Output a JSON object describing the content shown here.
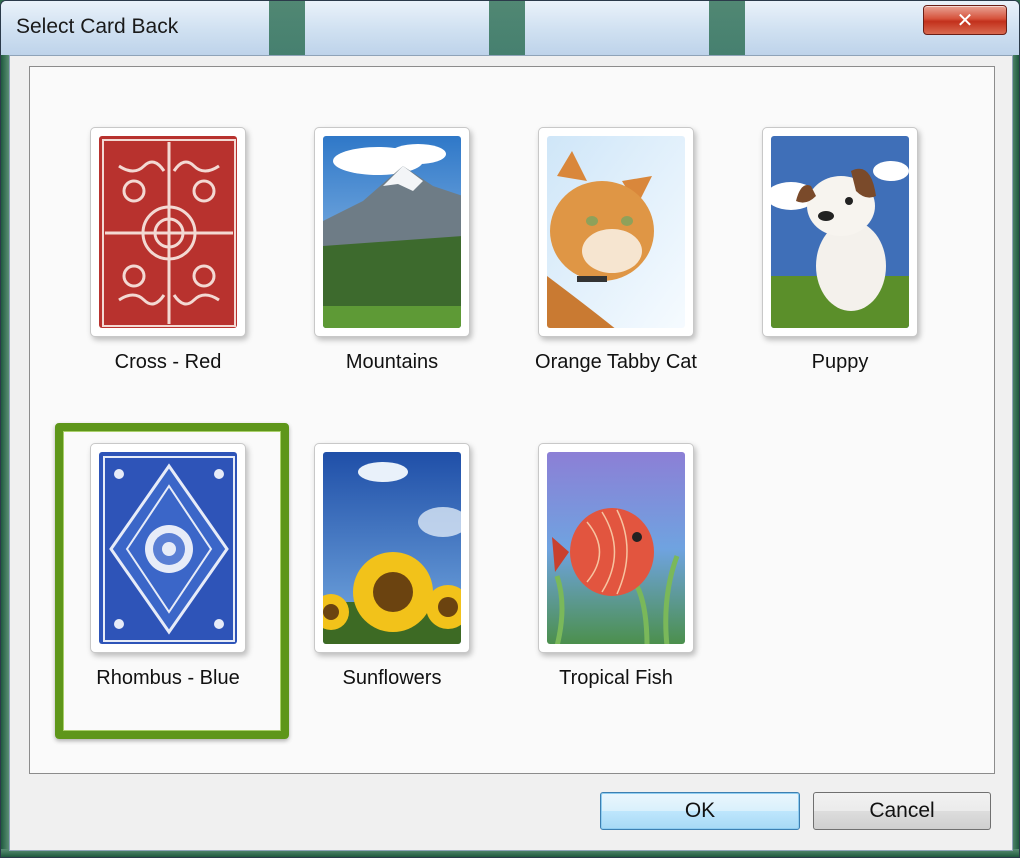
{
  "window": {
    "title": "Select Card Back",
    "close_label": "✕"
  },
  "cards": [
    {
      "label": "Cross - Red",
      "selected": false
    },
    {
      "label": "Mountains",
      "selected": false
    },
    {
      "label": "Orange Tabby Cat",
      "selected": false
    },
    {
      "label": "Puppy",
      "selected": false
    },
    {
      "label": "Rhombus - Blue",
      "selected": true
    },
    {
      "label": "Sunflowers",
      "selected": false
    },
    {
      "label": "Tropical Fish",
      "selected": false
    }
  ],
  "buttons": {
    "ok": "OK",
    "cancel": "Cancel"
  },
  "colors": {
    "selection": "#5e961a",
    "ok_button": "#bee6fd",
    "frame": "#2f6b4b"
  }
}
